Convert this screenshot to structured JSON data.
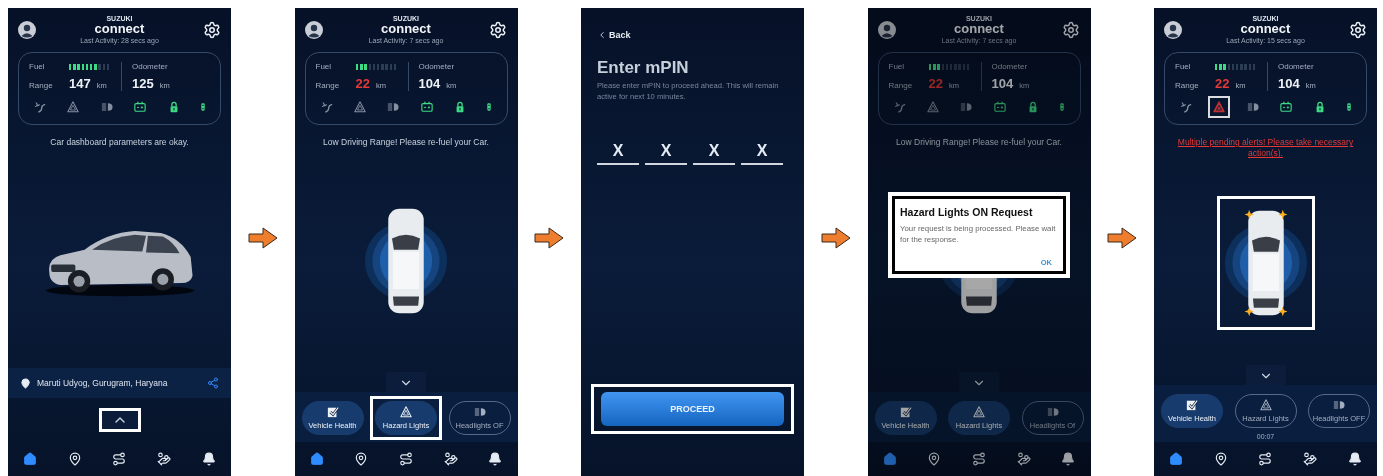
{
  "screens": [
    {
      "kind": "dashboard",
      "dimmed": false,
      "brand_top": "SUZUKI",
      "brand": "connect",
      "last_activity": "Last Activity: 28 secs ago",
      "fuel": {
        "label": "Fuel",
        "level": 0.7
      },
      "range": {
        "label": "Range",
        "value": "147",
        "unit": "km",
        "low": false
      },
      "odometer": {
        "label": "Odometer",
        "value": "125",
        "unit": "km"
      },
      "indicators": [
        {
          "kind": "defrost",
          "active": false,
          "alert": false,
          "highlighted": false
        },
        {
          "kind": "hazard",
          "active": false,
          "alert": false,
          "highlighted": false
        },
        {
          "kind": "headlight",
          "active": false,
          "alert": false,
          "highlighted": false
        },
        {
          "kind": "battery",
          "active": true,
          "alert": false,
          "highlighted": false
        },
        {
          "kind": "lock",
          "active": true,
          "alert": false,
          "highlighted": false
        },
        {
          "kind": "vehicle",
          "active": true,
          "alert": false,
          "highlighted": false
        }
      ],
      "message": {
        "text": "Car dashboard parameters are okay.",
        "alert": false
      },
      "car": {
        "kind": "side",
        "flashing": false,
        "highlighted": false
      },
      "location": "Maruti Udyog, Gurugram, Haryana",
      "handle": {
        "kind": "up",
        "highlighted": true
      },
      "nav": [
        {
          "kind": "home",
          "selected": true
        },
        {
          "kind": "locate",
          "selected": false
        },
        {
          "kind": "route",
          "selected": false
        },
        {
          "kind": "service",
          "selected": false
        },
        {
          "kind": "alerts",
          "selected": false
        }
      ]
    },
    {
      "kind": "dashboard",
      "dimmed": false,
      "brand_top": "SUZUKI",
      "brand": "connect",
      "last_activity": "Last Activity: 7 secs ago",
      "fuel": {
        "label": "Fuel",
        "level": 0.3
      },
      "range": {
        "label": "Range",
        "value": "22",
        "unit": "km",
        "low": true
      },
      "odometer": {
        "label": "Odometer",
        "value": "104",
        "unit": "km"
      },
      "indicators": [
        {
          "kind": "defrost",
          "active": false,
          "alert": false,
          "highlighted": false
        },
        {
          "kind": "hazard",
          "active": false,
          "alert": false,
          "highlighted": false
        },
        {
          "kind": "headlight",
          "active": false,
          "alert": false,
          "highlighted": false
        },
        {
          "kind": "battery",
          "active": true,
          "alert": false,
          "highlighted": false
        },
        {
          "kind": "lock",
          "active": true,
          "alert": false,
          "highlighted": false
        },
        {
          "kind": "vehicle",
          "active": true,
          "alert": false,
          "highlighted": false
        }
      ],
      "message": {
        "text": "Low Driving Range! Please re-fuel your Car.",
        "alert": false
      },
      "car": {
        "kind": "top",
        "flashing": false,
        "highlighted": false
      },
      "handle": {
        "kind": "down",
        "highlighted": false
      },
      "actions": [
        {
          "kind": "health",
          "label": "Vehicle Health",
          "selected": true,
          "highlighted": false
        },
        {
          "kind": "hazard",
          "label": "Hazard Lights",
          "selected": true,
          "highlighted": true
        },
        {
          "kind": "headlight",
          "label": "Headlights OF",
          "selected": false,
          "highlighted": false
        }
      ],
      "nav": [
        {
          "kind": "home",
          "selected": true
        },
        {
          "kind": "locate",
          "selected": false
        },
        {
          "kind": "route",
          "selected": false
        },
        {
          "kind": "service",
          "selected": false
        },
        {
          "kind": "alerts",
          "selected": false
        }
      ]
    },
    {
      "kind": "pin",
      "back": "Back",
      "title": "Enter mPIN",
      "text": "Please enter mPIN to proceed ahead. This will remain active for next 10 minutes.",
      "digits": [
        "X",
        "X",
        "X",
        "X"
      ],
      "button": {
        "label": "PROCEED",
        "highlighted": true
      }
    },
    {
      "kind": "dashboard",
      "dimmed": true,
      "brand_top": "SUZUKI",
      "brand": "connect",
      "last_activity": "Last Activity: 7 secs ago",
      "fuel": {
        "label": "Fuel",
        "level": 0.3
      },
      "range": {
        "label": "Range",
        "value": "22",
        "unit": "km",
        "low": true
      },
      "odometer": {
        "label": "Odometer",
        "value": "104",
        "unit": "km"
      },
      "indicators": [
        {
          "kind": "defrost",
          "active": false,
          "alert": false,
          "highlighted": false
        },
        {
          "kind": "hazard",
          "active": false,
          "alert": false,
          "highlighted": false
        },
        {
          "kind": "headlight",
          "active": false,
          "alert": false,
          "highlighted": false
        },
        {
          "kind": "battery",
          "active": true,
          "alert": false,
          "highlighted": false
        },
        {
          "kind": "lock",
          "active": true,
          "alert": false,
          "highlighted": false
        },
        {
          "kind": "vehicle",
          "active": true,
          "alert": false,
          "highlighted": false
        }
      ],
      "message": {
        "text": "Low Driving Range! Please re-fuel your Car.",
        "alert": false
      },
      "car": {
        "kind": "top",
        "flashing": false,
        "highlighted": false
      },
      "handle": {
        "kind": "down",
        "highlighted": false
      },
      "actions": [
        {
          "kind": "health",
          "label": "Vehicle Health",
          "selected": true,
          "highlighted": false
        },
        {
          "kind": "hazard",
          "label": "Hazard Lights",
          "selected": true,
          "highlighted": false
        },
        {
          "kind": "headlight",
          "label": "Headlights Of",
          "selected": false,
          "highlighted": false
        }
      ],
      "dialog": {
        "title": "Hazard Lights ON Request",
        "text": "Your request is being processed. Please wait for the response.",
        "button": "OK",
        "highlighted": true
      },
      "nav": [
        {
          "kind": "home",
          "selected": true
        },
        {
          "kind": "locate",
          "selected": false
        },
        {
          "kind": "route",
          "selected": false
        },
        {
          "kind": "service",
          "selected": false
        },
        {
          "kind": "alerts",
          "selected": false
        }
      ]
    },
    {
      "kind": "dashboard",
      "dimmed": false,
      "brand_top": "SUZUKI",
      "brand": "connect",
      "last_activity": "Last Activity: 15 secs ago",
      "fuel": {
        "label": "Fuel",
        "level": 0.3
      },
      "range": {
        "label": "Range",
        "value": "22",
        "unit": "km",
        "low": true
      },
      "odometer": {
        "label": "Odometer",
        "value": "104",
        "unit": "km"
      },
      "indicators": [
        {
          "kind": "defrost",
          "active": false,
          "alert": false,
          "highlighted": false
        },
        {
          "kind": "hazard",
          "active": false,
          "alert": true,
          "highlighted": true
        },
        {
          "kind": "headlight",
          "active": false,
          "alert": false,
          "highlighted": false
        },
        {
          "kind": "battery",
          "active": true,
          "alert": false,
          "highlighted": false
        },
        {
          "kind": "lock",
          "active": true,
          "alert": false,
          "highlighted": false
        },
        {
          "kind": "vehicle",
          "active": true,
          "alert": false,
          "highlighted": false
        }
      ],
      "message": {
        "text": "Multiple pending alerts! Please take necessary action(s).",
        "alert": true
      },
      "car": {
        "kind": "top",
        "flashing": true,
        "highlighted": true
      },
      "handle": {
        "kind": "down",
        "highlighted": false
      },
      "actions": [
        {
          "kind": "health",
          "label": "Vehicle Health",
          "selected": true,
          "highlighted": false
        },
        {
          "kind": "hazard",
          "label": "Hazard Lights",
          "selected": false,
          "highlighted": false,
          "timer": "00:07"
        },
        {
          "kind": "headlight",
          "label": "Headlights OFF",
          "selected": false,
          "highlighted": false
        }
      ],
      "nav": [
        {
          "kind": "home",
          "selected": true
        },
        {
          "kind": "locate",
          "selected": false
        },
        {
          "kind": "route",
          "selected": false
        },
        {
          "kind": "service",
          "selected": false
        },
        {
          "kind": "alerts",
          "selected": false
        }
      ]
    }
  ]
}
